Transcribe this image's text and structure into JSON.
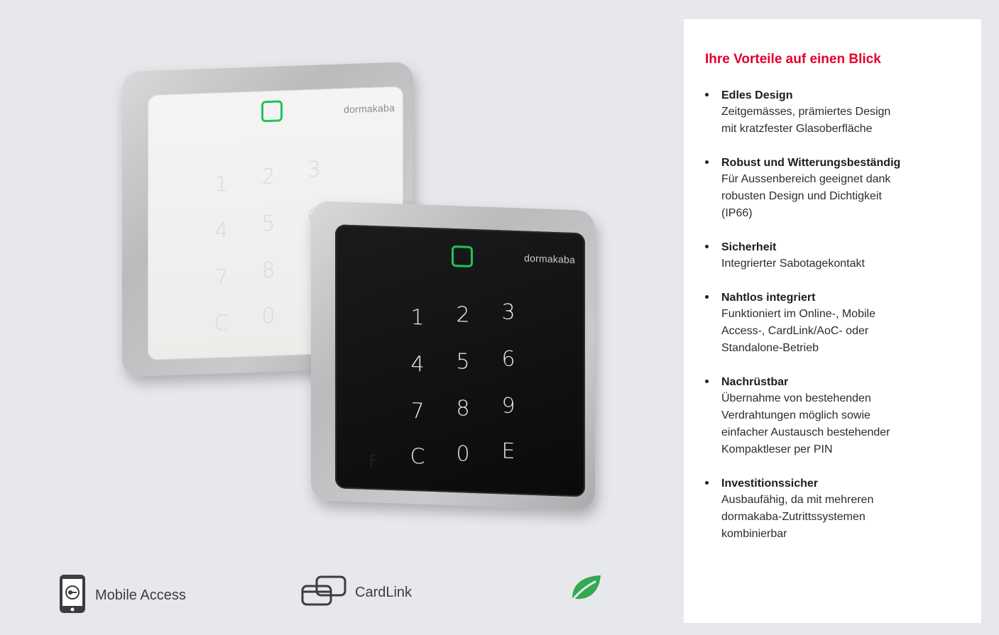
{
  "product": {
    "brand": "dormakaba",
    "white_keys": [
      "1",
      "2",
      "3",
      "4",
      "5",
      "6",
      "7",
      "8",
      "C",
      "0"
    ],
    "black_keys": [
      "1",
      "2",
      "3",
      "4",
      "5",
      "6",
      "7",
      "8",
      "9",
      "C",
      "0",
      "E"
    ],
    "f_key": "F",
    "colors": {
      "reader_led": "#1fc45a"
    }
  },
  "features": [
    {
      "label": "Mobile Access",
      "icon": "smartphone-icon"
    },
    {
      "label": "CardLink",
      "icon": "cardlink-icon"
    },
    {
      "label": "",
      "icon": "leaf-icon"
    }
  ],
  "panel": {
    "title": "Ihre Vorteile auf einen Blick",
    "title_color": "#e4002b",
    "items": [
      {
        "title": "Edles Design",
        "text": "Zeitgemässes, prämiertes Design\nmit kratzfester Glasoberfläche"
      },
      {
        "title": "Robust und Witterungsbeständig",
        "text": "Für Aussenbereich geeignet dank\nrobusten Design und Dichtigkeit\n(IP66)"
      },
      {
        "title": "Sicherheit",
        "text": "Integrierter Sabotagekontakt"
      },
      {
        "title": "Nahtlos integriert",
        "text": "Funktioniert im Online-, Mobile\nAccess-, CardLink/AoC- oder\nStandalone-Betrieb"
      },
      {
        "title": "Nachrüstbar",
        "text": "Übernahme von bestehenden\nVerdrahtungen möglich sowie\neinfacher Austausch bestehender\nKompaktleser per PIN"
      },
      {
        "title": "Investitionssicher",
        "text": "Ausbaufähig, da mit mehreren\ndormakaba-Zutrittssystemen\nkombinierbar"
      }
    ]
  }
}
